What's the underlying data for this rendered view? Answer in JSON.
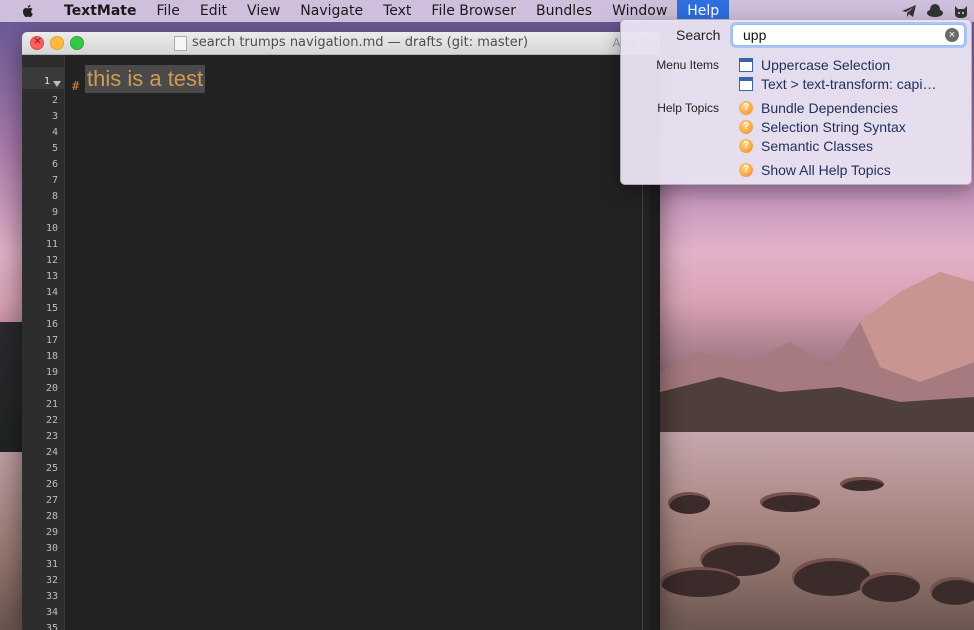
{
  "menubar": {
    "app_name": "TextMate",
    "items": [
      "File",
      "Edit",
      "View",
      "Navigate",
      "Text",
      "File Browser",
      "Bundles",
      "Window",
      "Help"
    ],
    "active_item": "Help"
  },
  "window": {
    "title": "search trumps navigation.md — drafts (git: master)",
    "right_label": "Add Lic"
  },
  "editor": {
    "line_numbers": [
      "1",
      "2",
      "3",
      "4",
      "5",
      "6",
      "7",
      "8",
      "9",
      "10",
      "11",
      "12",
      "13",
      "14",
      "15",
      "16",
      "17",
      "18",
      "19",
      "20",
      "21",
      "22",
      "23",
      "24",
      "25",
      "26",
      "27",
      "28",
      "29",
      "30",
      "31",
      "32",
      "33",
      "34",
      "35"
    ],
    "heading_marker": "#",
    "heading_text": "this is a test"
  },
  "help_popup": {
    "search_label": "Search",
    "search_value": "upp",
    "menu_items_label": "Menu Items",
    "menu_items": [
      "Uppercase Selection",
      "Text > text-transform: capi…"
    ],
    "help_topics_label": "Help Topics",
    "help_topics": [
      "Bundle Dependencies",
      "Selection String Syntax",
      "Semantic Classes"
    ],
    "show_all": "Show All Help Topics"
  },
  "colors": {
    "accent": "#2f6fde",
    "heading_text": "#d19a54",
    "editor_bg": "#222222"
  }
}
